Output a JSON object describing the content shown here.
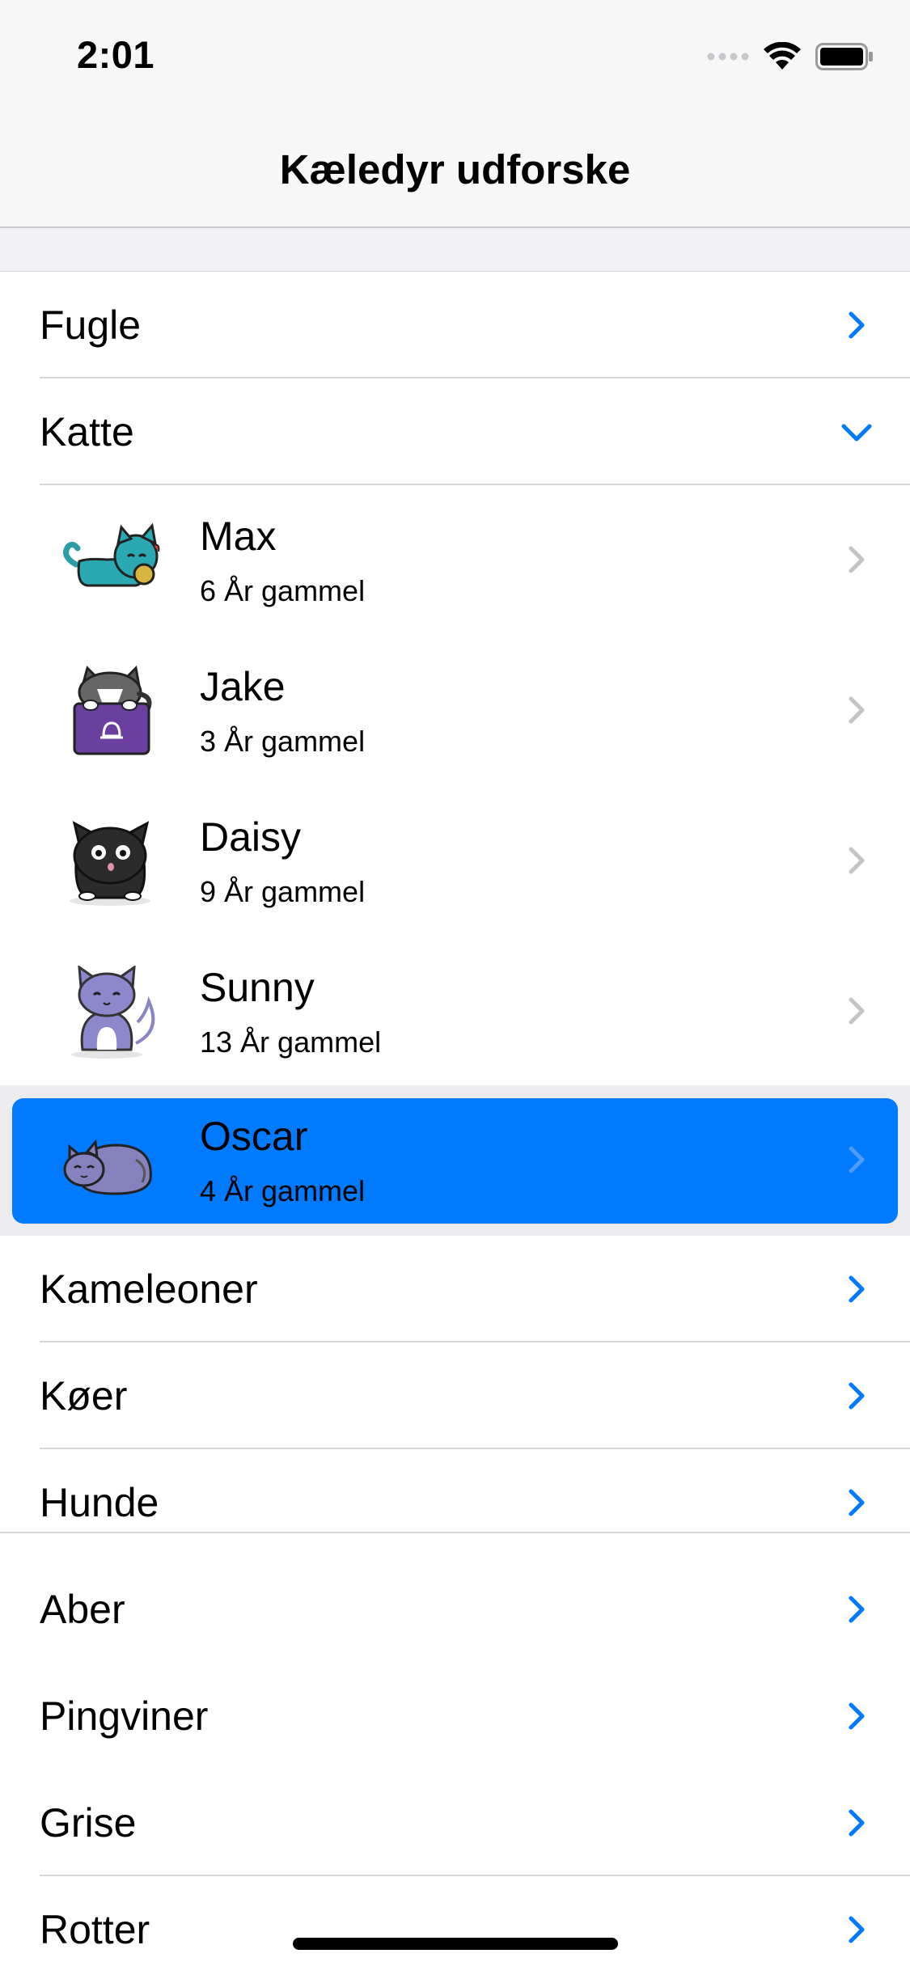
{
  "status": {
    "time": "2:01"
  },
  "nav": {
    "title": "Kæledyr udforske"
  },
  "categories_top": [
    {
      "label": "Fugle",
      "state": "collapsed"
    },
    {
      "label": "Katte",
      "state": "expanded"
    }
  ],
  "cats": [
    {
      "name": "Max",
      "age": "6 År gammel",
      "icon": "teal-cat-icon"
    },
    {
      "name": "Jake",
      "age": "3 År gammel",
      "icon": "cat-on-box-icon"
    },
    {
      "name": "Daisy",
      "age": "9 År gammel",
      "icon": "black-cat-icon"
    },
    {
      "name": "Sunny",
      "age": "13 År gammel",
      "icon": "purple-cat-icon"
    },
    {
      "name": "Oscar",
      "age": "4 År gammel",
      "icon": "sleeping-cat-icon",
      "selected": true
    }
  ],
  "categories_bottom": [
    {
      "label": "Kameleoner"
    },
    {
      "label": "Køer"
    },
    {
      "label": "Hunde"
    },
    {
      "label": "Aber"
    },
    {
      "label": "Pingviner"
    },
    {
      "label": "Grise"
    },
    {
      "label": "Rotter"
    }
  ],
  "colors": {
    "accent": "#007aff",
    "chevron_gray": "#c4c4c7",
    "separator": "#d6d6d9"
  }
}
